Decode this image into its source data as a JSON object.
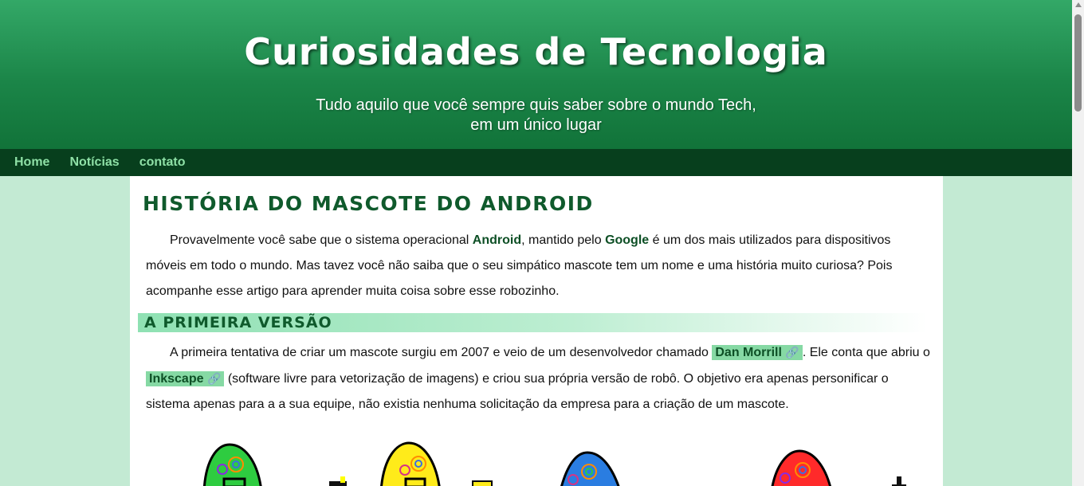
{
  "header": {
    "site_title": "Curiosidades de Tecnologia",
    "tagline_line1": "Tudo aquilo que você sempre quis saber sobre o mundo Tech,",
    "tagline_line2": "em um único lugar"
  },
  "nav": {
    "items": [
      {
        "label": "Home"
      },
      {
        "label": "Notícias"
      },
      {
        "label": "contato"
      }
    ]
  },
  "article": {
    "title": "História do mascote do Android",
    "intro": {
      "part1": "Provavelmente você sabe que o sistema operacional ",
      "android": "Android",
      "part2": ", mantido pelo ",
      "google": "Google",
      "part3": " é um dos mais utilizados para dispositivos móveis em todo o mundo. Mas tavez você não saiba que o seu simpático mascote tem um nome e uma história muito curiosa? Pois acompanhe esse artigo para aprender muita coisa sobre esse robozinho."
    },
    "section1": {
      "heading": "A primeira versão",
      "part1": "A primeira tentativa de criar um mascote surgiu em 2007 e veio de um desenvolvedor chamado ",
      "link1": "Dan Morrill",
      "part2": ". Ele conta que abriu o ",
      "link2": "Inkscape",
      "part3": " (software livre para vetorização de imagens) e criou sua própria versão de robô. O objetivo era apenas personificar o sistema apenas para a a sua equipe, não existia nenhuma solicitação da empresa para a criação de um mascote."
    }
  },
  "icons": {
    "external_link": "🔗"
  },
  "colors": {
    "header_green": "#1b8548",
    "nav_bg": "#073f1d",
    "nav_link": "#8ee0a6",
    "page_bg": "#c3ead3",
    "heading_green": "#0f5a2c",
    "link_highlight": "#86d9a4",
    "mascot_colors": [
      "#2ecc40",
      "#ffeb1a",
      "#2a7de1",
      "#ff2a2a"
    ]
  }
}
